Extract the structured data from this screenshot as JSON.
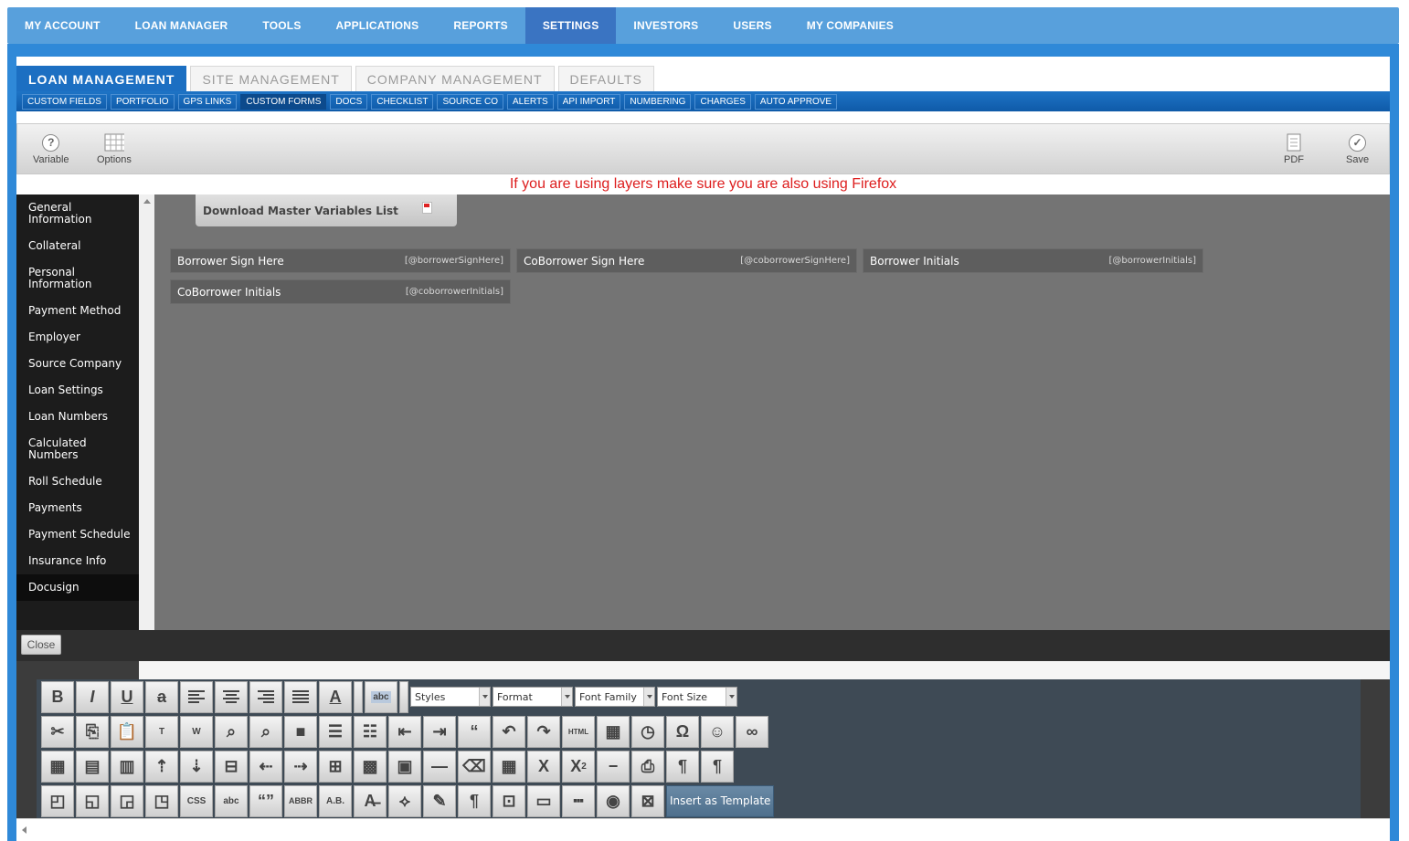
{
  "top_nav": [
    "MY ACCOUNT",
    "LOAN MANAGER",
    "TOOLS",
    "APPLICATIONS",
    "REPORTS",
    "SETTINGS",
    "INVESTORS",
    "USERS",
    "MY COMPANIES"
  ],
  "tabs": [
    "LOAN MANAGEMENT",
    "SITE MANAGEMENT",
    "COMPANY MANAGEMENT",
    "DEFAULTS"
  ],
  "subtabs": [
    "CUSTOM FIELDS",
    "PORTFOLIO",
    "GPS LINKS",
    "CUSTOM FORMS",
    "DOCS",
    "CHECKLIST",
    "SOURCE CO",
    "ALERTS",
    "API IMPORT",
    "NUMBERING",
    "CHARGES",
    "AUTO APPROVE"
  ],
  "toolbar": {
    "variable": "Variable",
    "options": "Options",
    "pdf": "PDF",
    "save": "Save"
  },
  "warning": "If you are using layers make sure you are also using Firefox",
  "sidebar": [
    "General Information",
    "Collateral",
    "Personal Information",
    "Payment Method",
    "Employer",
    "Source Company",
    "Loan Settings",
    "Loan Numbers",
    "Calculated Numbers",
    "Roll Schedule",
    "Payments",
    "Payment Schedule",
    "Insurance Info",
    "Docusign"
  ],
  "download_label": "Download Master Variables List",
  "variables": [
    {
      "label": "Borrower Sign Here",
      "tag": "[@borrowerSignHere]"
    },
    {
      "label": "CoBorrower Sign Here",
      "tag": "[@coborrowerSignHere]"
    },
    {
      "label": "Borrower Initials",
      "tag": "[@borrowerInitials]"
    },
    {
      "label": "CoBorrower Initials",
      "tag": "[@coborrowerInitials]"
    }
  ],
  "close_label": "Close",
  "editor": {
    "dropdowns": [
      "Styles",
      "Format",
      "Font Family",
      "Font Size"
    ],
    "abc_label": "abc",
    "insert_template": "Insert as Template",
    "row3_text": {
      "css": "CSS",
      "abbr": "ABBR",
      "ab": "A.B.",
      "html": "HTML",
      "x2": "X",
      "sup": "2"
    }
  },
  "colors": {
    "nav": "#58a0dc",
    "nav_active": "#3a74c2",
    "warning": "#dd1d1d",
    "canvas": "#747474"
  }
}
